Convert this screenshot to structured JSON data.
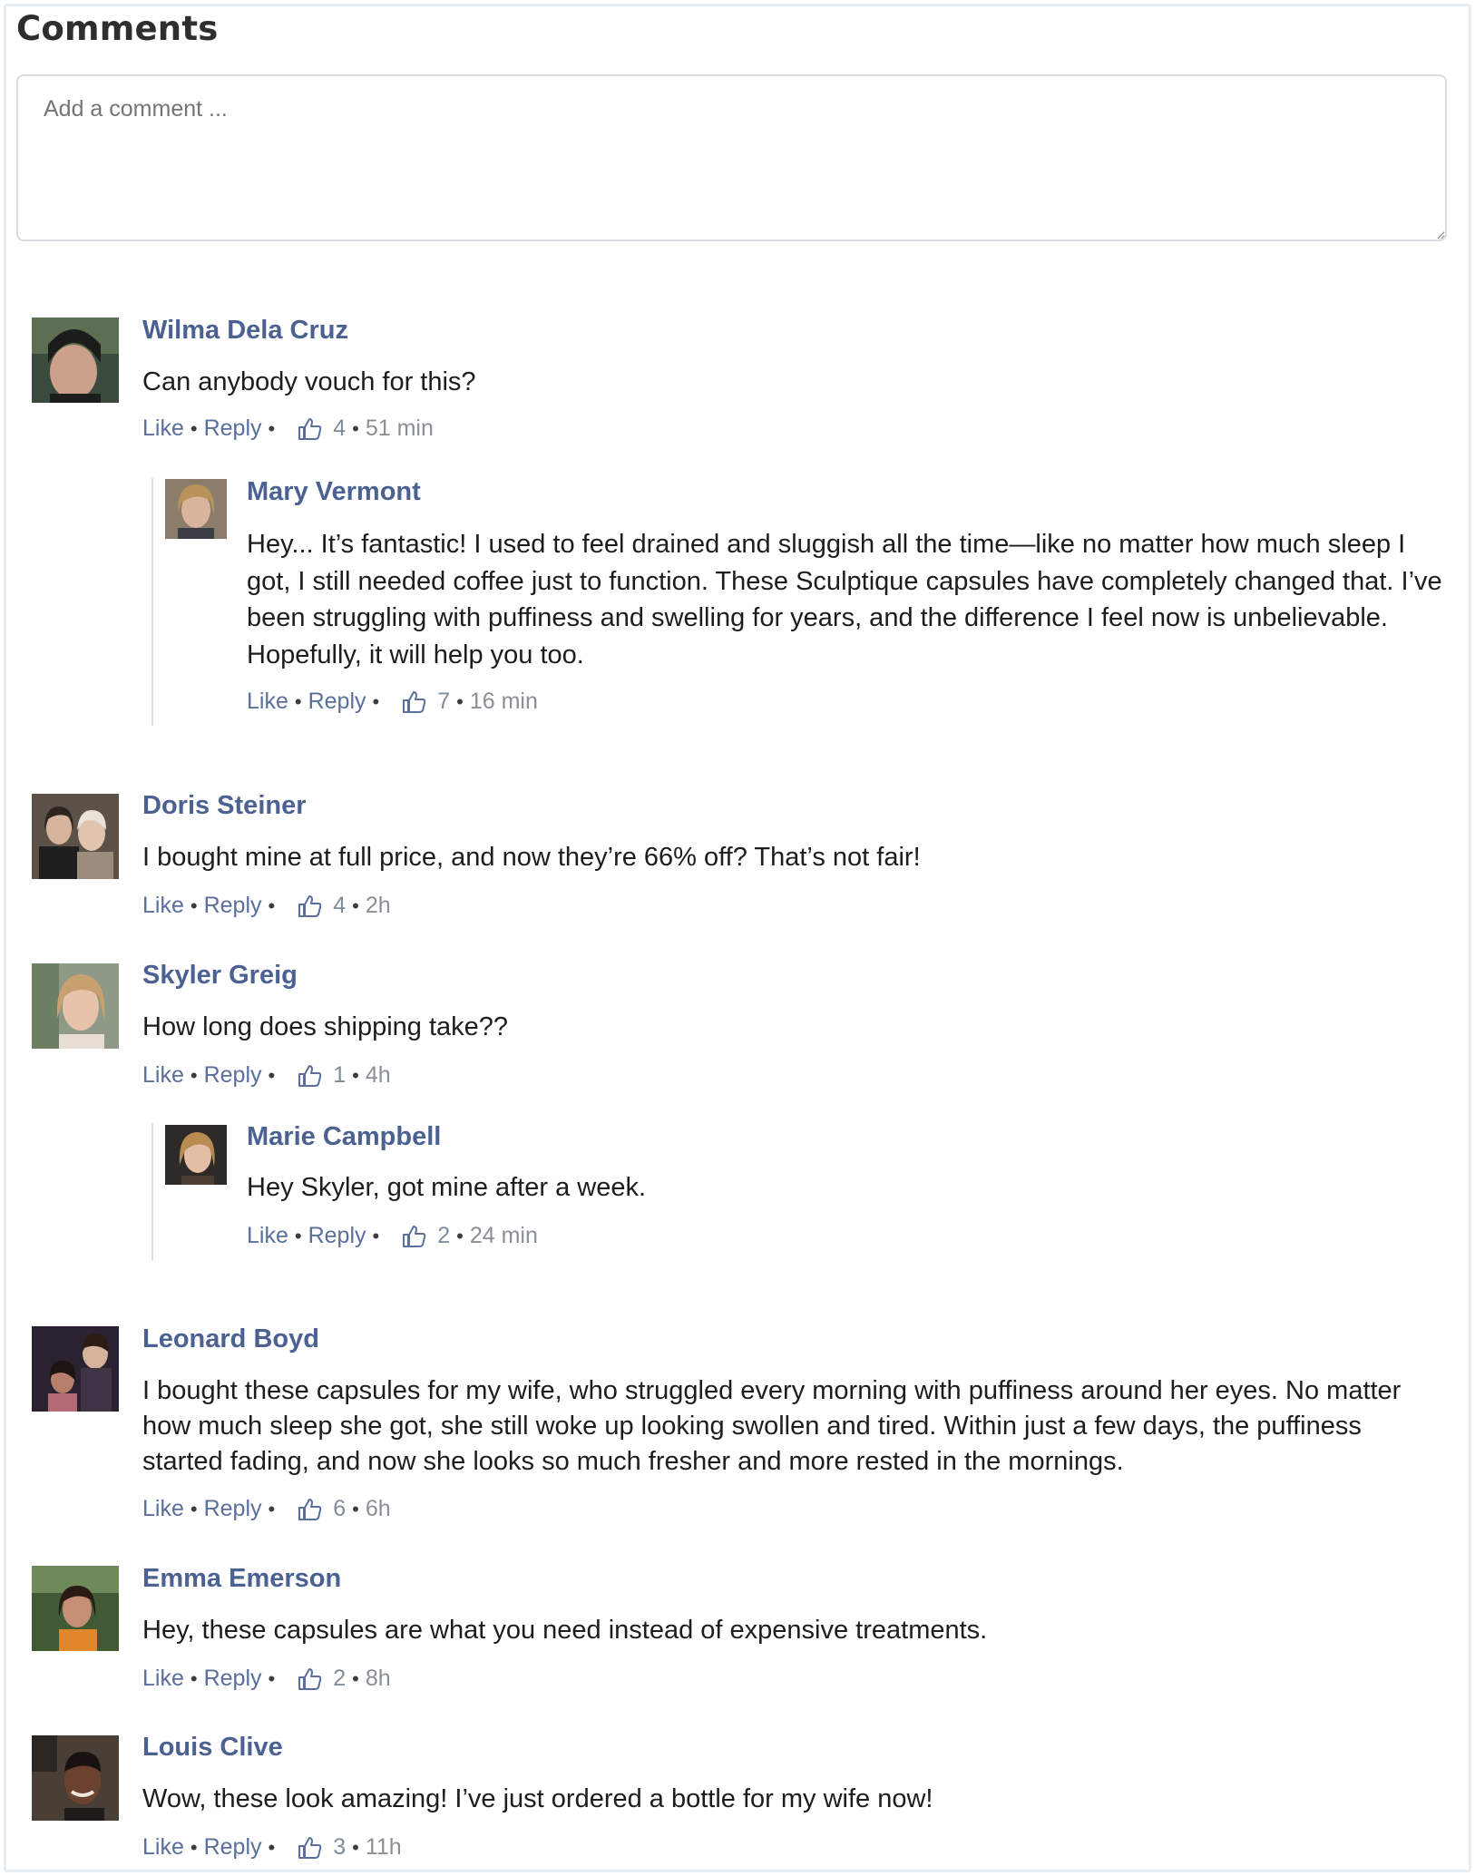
{
  "page": {
    "title": "Comments"
  },
  "comment_input": {
    "placeholder": "Add a comment ..."
  },
  "actions": {
    "like": "Like",
    "reply": "Reply"
  },
  "comments": [
    {
      "name": "Wilma Dela Cruz",
      "text": "Can anybody vouch for this?",
      "likes": "4",
      "time": "51 min"
    },
    {
      "name": "Mary Vermont",
      "reply_to": "Wilma Dela Cruz",
      "text": "Hey... It’s fantastic! I used to feel drained and sluggish all the time—like no matter how much sleep I got, I still needed coffee just to function. These Sculptique capsules have completely changed that. I’ve been struggling with puffiness and swelling for years, and the difference I feel now is unbelievable. Hopefully, it will help you too.",
      "likes": "7",
      "time": "16 min"
    },
    {
      "name": "Doris Steiner",
      "text": "I bought mine at full price, and now they’re 66% off? That’s not fair!",
      "likes": "4",
      "time": "2h"
    },
    {
      "name": "Skyler Greig",
      "text": "How long does shipping take??",
      "likes": "1",
      "time": "4h"
    },
    {
      "name": "Marie Campbell",
      "reply_to": "Skyler Greig",
      "text": "Hey Skyler, got mine after a week.",
      "likes": "2",
      "time": "24 min"
    },
    {
      "name": "Leonard Boyd",
      "text": "I bought these capsules for my wife, who struggled every morning with puffiness around her eyes. No matter how much sleep she got, she still woke up looking swollen and tired. Within just a few days, the puffiness started fading, and now she looks so much fresher and more rested in the mornings.",
      "likes": "6",
      "time": "6h"
    },
    {
      "name": "Emma Emerson",
      "text": "Hey, these capsules are what you need instead of expensive treatments.",
      "likes": "2",
      "time": "8h"
    },
    {
      "name": "Louis Clive",
      "text": "Wow, these look amazing! I’ve just ordered a bottle for my wife now!",
      "likes": "3",
      "time": "11h"
    }
  ],
  "icons": {
    "like": "thumbs-up-icon",
    "resize": "resize-grip-icon"
  },
  "colors": {
    "name": "#4a6192",
    "link": "#5a6f9c",
    "meta": "#7f8c9a",
    "text": "#1d1d1d",
    "heading": "#2e2e2e"
  }
}
